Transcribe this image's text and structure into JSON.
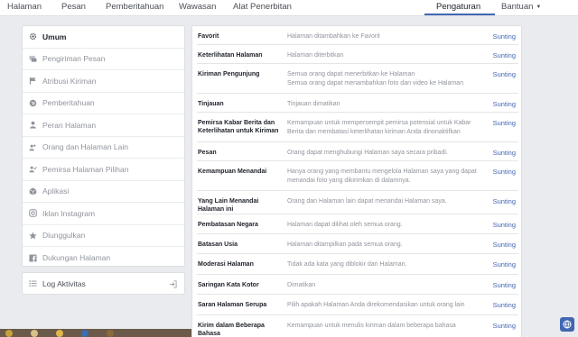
{
  "topnav": {
    "tabs": [
      "Halaman",
      "Pesan",
      "Pemberitahuan",
      "Wawasan",
      "Alat Penerbitan"
    ],
    "active_tab": "Pengaturan",
    "help": "Bantuan"
  },
  "sidebar": {
    "items": [
      {
        "label": "Umum",
        "icon": "gear-icon"
      },
      {
        "label": "Pengiriman Pesan",
        "icon": "chat-icon"
      },
      {
        "label": "Atribusi Kiriman",
        "icon": "flag-icon"
      },
      {
        "label": "Pemberitahuan",
        "icon": "globe-icon"
      },
      {
        "label": "Peran Halaman",
        "icon": "person-icon"
      },
      {
        "label": "Orang dan Halaman Lain",
        "icon": "people-icon"
      },
      {
        "label": "Pemirsa Halaman Pilihan",
        "icon": "audience-icon"
      },
      {
        "label": "Aplikasi",
        "icon": "cube-icon"
      },
      {
        "label": "Iklan Instagram",
        "icon": "instagram-icon"
      },
      {
        "label": "Diunggulkan",
        "icon": "star-icon"
      },
      {
        "label": "Dukungan Halaman",
        "icon": "facebook-icon"
      }
    ],
    "log_label": "Log Aktivitas"
  },
  "settings": {
    "edit_label": "Sunting",
    "rows": [
      {
        "label": "Favorit",
        "value": "Halaman ditambahkan ke Favorit"
      },
      {
        "label": "Keterlihatan Halaman",
        "value": "Halaman diterbitkan"
      },
      {
        "label": "Kiriman Pengunjung",
        "value": "Semua orang dapat menerbitkan ke Halaman\nSemua orang dapat menambahkan foto dan video ke Halaman"
      },
      {
        "label": "Tinjauan",
        "value": "Tinjauan dimatikan"
      },
      {
        "label": "Pemirsa Kabar Berita dan Keterlihatan untuk Kiriman",
        "value": "Kemampuan untuk mempersempit pemirsa potensial untuk Kabar Berita dan membatasi keterlihatan kiriman Anda dinonaktifkan"
      },
      {
        "label": "Pesan",
        "value": "Orang dapat menghubungi Halaman saya secara pribadi."
      },
      {
        "label": "Kemampuan Menandai",
        "value": "Hanya orang yang membantu mengelola Halaman saya yang dapat menandai foto yang dikirimkan di dalamnya."
      },
      {
        "label": "Yang Lain Menandai Halaman ini",
        "value": "Orang dan Halaman lain dapat menandai Halaman saya."
      },
      {
        "label": "Pembatasan Negara",
        "value": "Halaman dapat dilihat oleh semua orang."
      },
      {
        "label": "Batasan Usia",
        "value": "Halaman ditampilkan pada semua orang."
      },
      {
        "label": "Moderasi Halaman",
        "value": "Tidak ada kata yang diblokir dari Halaman."
      },
      {
        "label": "Saringan Kata Kotor",
        "value": "Dimatikan"
      },
      {
        "label": "Saran Halaman Serupa",
        "value": "Pilih apakah Halaman Anda direkomendasikan untuk orang lain"
      },
      {
        "label": "Kirim dalam Beberapa Bahasa",
        "value": "Kemampuan untuk menulis kiriman dalam beberapa bahasa"
      }
    ]
  },
  "colors": {
    "accent": "#4267b2",
    "muted": "#90949c",
    "page_bg": "#e9ebee"
  }
}
